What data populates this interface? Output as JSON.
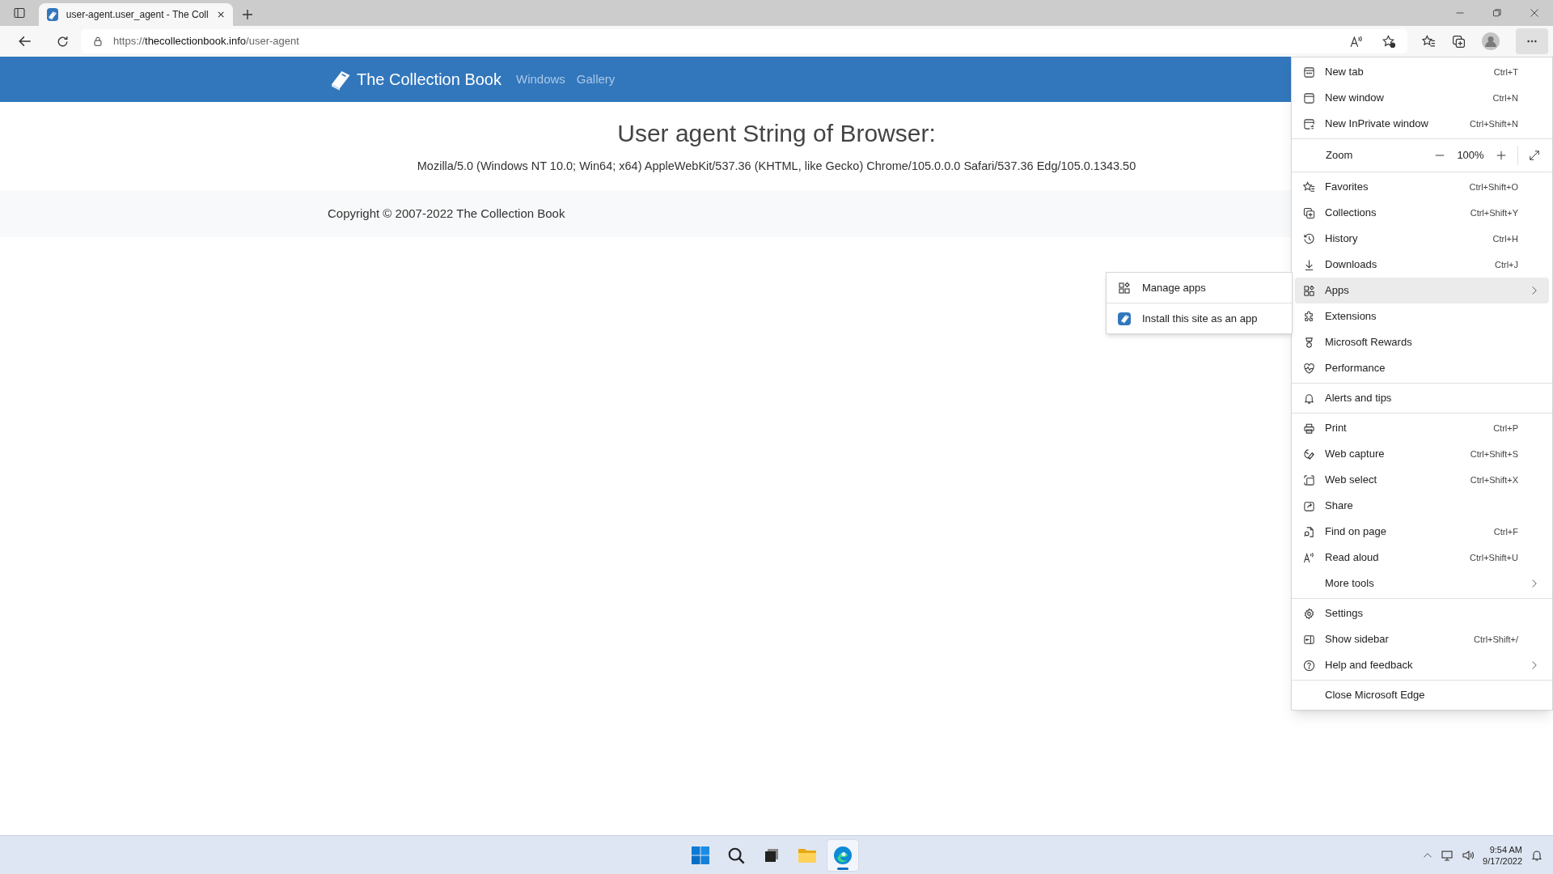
{
  "browser": {
    "tab": {
      "title": "user-agent.user_agent - The Coll",
      "selected": true
    },
    "address": {
      "scheme": "https://",
      "host": "thecollectionbook.info",
      "path": "/user-agent"
    }
  },
  "site": {
    "brand": "The Collection Book",
    "nav": [
      "Windows",
      "Gallery"
    ],
    "heading": "User agent String of Browser:",
    "user_agent": "Mozilla/5.0 (Windows NT 10.0; Win64; x64) AppleWebKit/537.36 (KHTML, like Gecko) Chrome/105.0.0.0 Safari/537.36 Edg/105.0.1343.50",
    "footer": "Copyright © 2007-2022 The Collection Book"
  },
  "menu": {
    "groups": [
      [
        {
          "label": "New tab",
          "shortcut": "Ctrl+T",
          "submenu": false,
          "selected": false
        },
        {
          "label": "New window",
          "shortcut": "Ctrl+N",
          "submenu": false,
          "selected": false
        },
        {
          "label": "New InPrivate window",
          "shortcut": "Ctrl+Shift+N",
          "submenu": false,
          "selected": false
        }
      ],
      [
        {
          "label": "Zoom",
          "kind": "zoom",
          "value": "100%"
        }
      ],
      [
        {
          "label": "Favorites",
          "shortcut": "Ctrl+Shift+O",
          "submenu": false,
          "selected": false
        },
        {
          "label": "Collections",
          "shortcut": "Ctrl+Shift+Y",
          "submenu": false,
          "selected": false
        },
        {
          "label": "History",
          "shortcut": "Ctrl+H",
          "submenu": false,
          "selected": false
        },
        {
          "label": "Downloads",
          "shortcut": "Ctrl+J",
          "submenu": false,
          "selected": false
        },
        {
          "label": "Apps",
          "submenu": true,
          "selected": true
        },
        {
          "label": "Extensions",
          "submenu": false,
          "selected": false
        },
        {
          "label": "Microsoft Rewards",
          "submenu": false,
          "selected": false
        },
        {
          "label": "Performance",
          "submenu": false,
          "selected": false
        }
      ],
      [
        {
          "label": "Alerts and tips",
          "submenu": false,
          "selected": false
        }
      ],
      [
        {
          "label": "Print",
          "shortcut": "Ctrl+P",
          "submenu": false,
          "selected": false
        },
        {
          "label": "Web capture",
          "shortcut": "Ctrl+Shift+S",
          "submenu": false,
          "selected": false
        },
        {
          "label": "Web select",
          "shortcut": "Ctrl+Shift+X",
          "submenu": false,
          "selected": false
        },
        {
          "label": "Share",
          "submenu": false,
          "selected": false
        },
        {
          "label": "Find on page",
          "shortcut": "Ctrl+F",
          "submenu": false,
          "selected": false
        },
        {
          "label": "Read aloud",
          "shortcut": "Ctrl+Shift+U",
          "submenu": false,
          "selected": false
        },
        {
          "label": "More tools",
          "submenu": true,
          "selected": false
        }
      ],
      [
        {
          "label": "Settings",
          "submenu": false,
          "selected": false
        },
        {
          "label": "Show sidebar",
          "shortcut": "Ctrl+Shift+/",
          "submenu": false,
          "selected": false
        },
        {
          "label": "Help and feedback",
          "submenu": true,
          "selected": false
        }
      ],
      [
        {
          "label": "Close Microsoft Edge",
          "submenu": false,
          "selected": false
        }
      ]
    ],
    "submenu": [
      {
        "label": "Manage apps"
      },
      {
        "label": "Install this site as an app"
      }
    ]
  },
  "taskbar": {
    "time": "9:54 AM",
    "date": "9/17/2022",
    "apps": [
      {
        "selected": false
      },
      {
        "selected": false
      },
      {
        "selected": false
      },
      {
        "selected": false
      },
      {
        "selected": true
      }
    ]
  }
}
